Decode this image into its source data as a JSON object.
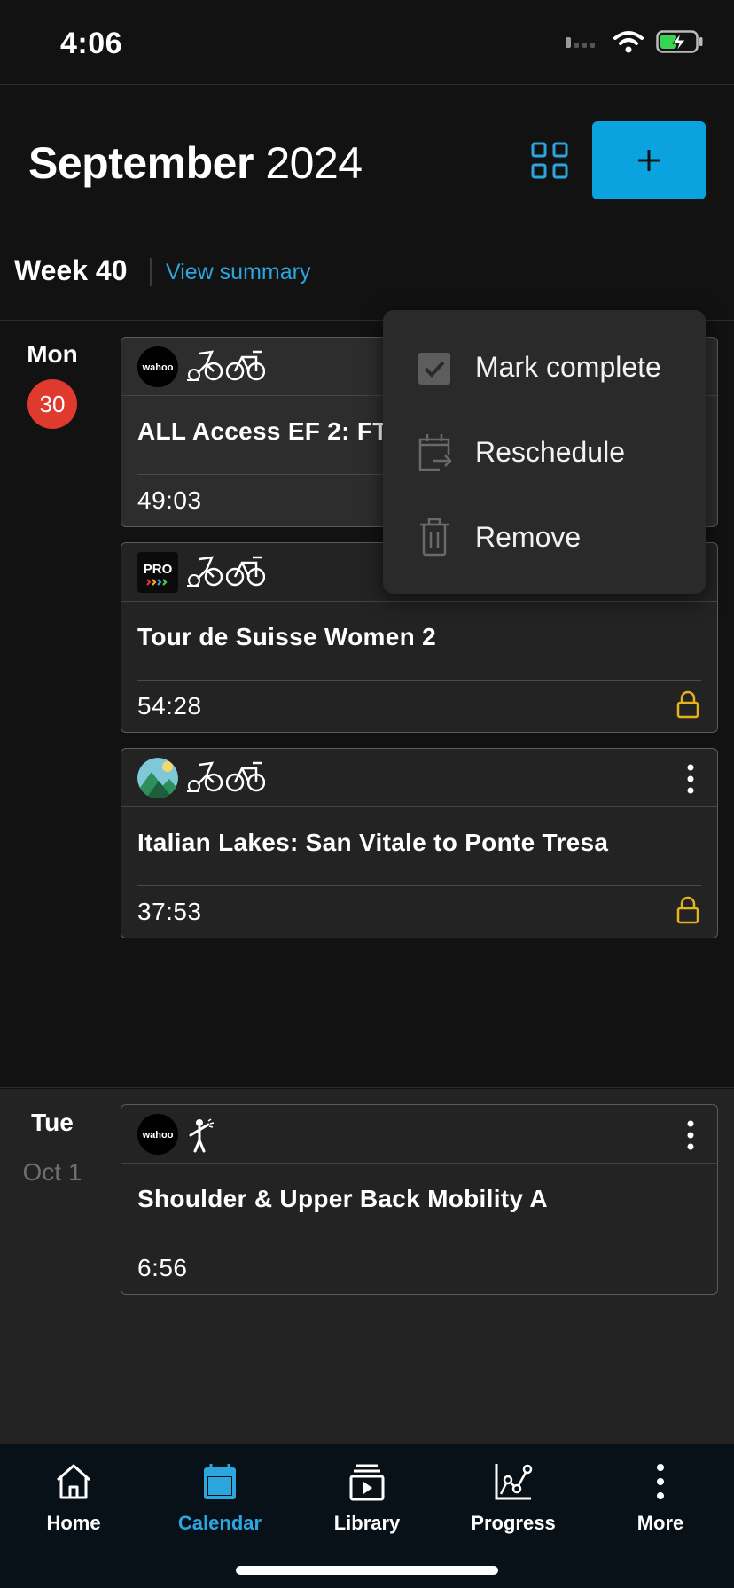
{
  "status": {
    "time": "4:06"
  },
  "header": {
    "month": "September",
    "year": "2024",
    "add_label": "+"
  },
  "week": {
    "label": "Week 40",
    "summary_link": "View summary"
  },
  "days": [
    {
      "name": "Mon",
      "date_badge": "30",
      "workouts": [
        {
          "title": "ALL Access EF 2: FT",
          "duration": "49:03",
          "provider": "wahoo",
          "locked": false
        },
        {
          "title": "Tour de Suisse Women 2",
          "duration": "54:28",
          "provider": "PRO",
          "locked": true
        },
        {
          "title": "Italian Lakes: San Vitale to Ponte Tresa",
          "duration": "37:53",
          "provider": "scenic",
          "locked": true
        }
      ]
    },
    {
      "name": "Tue",
      "date": "Oct 1",
      "workouts": [
        {
          "title": "Shoulder & Upper Back Mobility A",
          "duration": "6:56",
          "provider": "wahoo",
          "locked": false
        }
      ]
    }
  ],
  "context_menu": {
    "items": [
      {
        "label": "Mark complete",
        "icon": "checkbox-icon"
      },
      {
        "label": "Reschedule",
        "icon": "calendar-arrow-icon"
      },
      {
        "label": "Remove",
        "icon": "trash-icon"
      }
    ]
  },
  "bottom_nav": {
    "items": [
      {
        "label": "Home",
        "icon": "home-icon"
      },
      {
        "label": "Calendar",
        "icon": "calendar-icon",
        "active": true
      },
      {
        "label": "Library",
        "icon": "library-icon"
      },
      {
        "label": "Progress",
        "icon": "progress-chart-icon"
      },
      {
        "label": "More",
        "icon": "more-vertical-icon"
      }
    ]
  },
  "colors": {
    "accent": "#0aa3e0",
    "link": "#2ba6de",
    "badge": "#e03a2f",
    "lock": "#e8b21a"
  }
}
